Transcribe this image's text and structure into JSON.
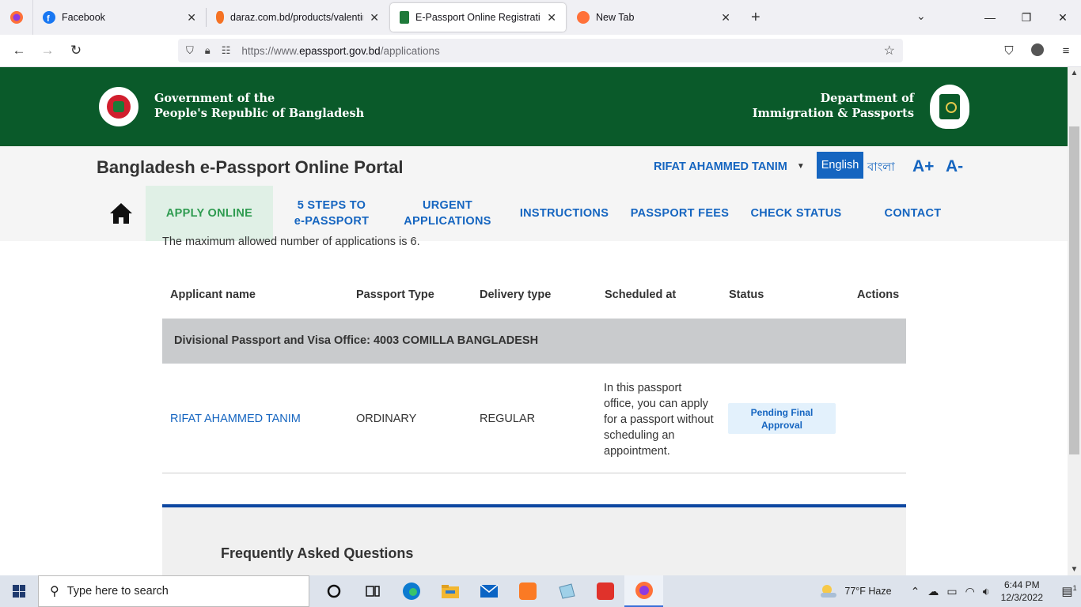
{
  "browser": {
    "tabs": [
      {
        "title": "Facebook",
        "active": false
      },
      {
        "title": "daraz.com.bd/products/valentin",
        "active": false
      },
      {
        "title": "E-Passport Online Registration P",
        "active": true
      },
      {
        "title": "New Tab",
        "active": false
      }
    ],
    "url_prefix": "https://www.",
    "url_host": "epassport.gov.bd",
    "url_path": "/applications"
  },
  "site": {
    "gov_line1": "Government of the",
    "gov_line2": "People's Republic of Bangladesh",
    "dept_line1": "Department of",
    "dept_line2": "Immigration & Passports",
    "portal_title": "Bangladesh e-Passport Online Portal",
    "user_name": "RIFAT AHAMMED TANIM",
    "lang_english": "English",
    "lang_bangla": "বাংলা",
    "font_increase": "A+",
    "font_decrease": "A-"
  },
  "menu": {
    "apply_online": "APPLY ONLINE",
    "steps_l1": "5 STEPS TO",
    "steps_l2": "e-PASSPORT",
    "urgent_l1": "URGENT",
    "urgent_l2": "APPLICATIONS",
    "instructions": "INSTRUCTIONS",
    "fees": "PASSPORT FEES",
    "check_status": "CHECK STATUS",
    "contact": "CONTACT"
  },
  "content": {
    "max_note": "The maximum allowed number of applications is 6.",
    "columns": [
      "Applicant name",
      "Passport Type",
      "Delivery type",
      "Scheduled at",
      "Status",
      "Actions"
    ],
    "office": "Divisional Passport and Visa Office: 4003 COMILLA BANGLADESH",
    "row": {
      "applicant": "RIFAT AHAMMED TANIM",
      "passport_type": "ORDINARY",
      "delivery_type": "REGULAR",
      "scheduled": "In this passport office, you can apply for a passport without scheduling an appointment.",
      "status_l1": "Pending Final",
      "status_l2": "Approval"
    },
    "faq_title": "Frequently Asked Questions"
  },
  "taskbar": {
    "search_placeholder": "Type here to search",
    "weather": "77°F  Haze",
    "time": "6:44 PM",
    "date": "12/3/2022",
    "notification_count": "1"
  },
  "colors": {
    "header_green": "#0a5a2a",
    "link_blue": "#1565c0",
    "active_menu_green": "#2e9b50"
  }
}
